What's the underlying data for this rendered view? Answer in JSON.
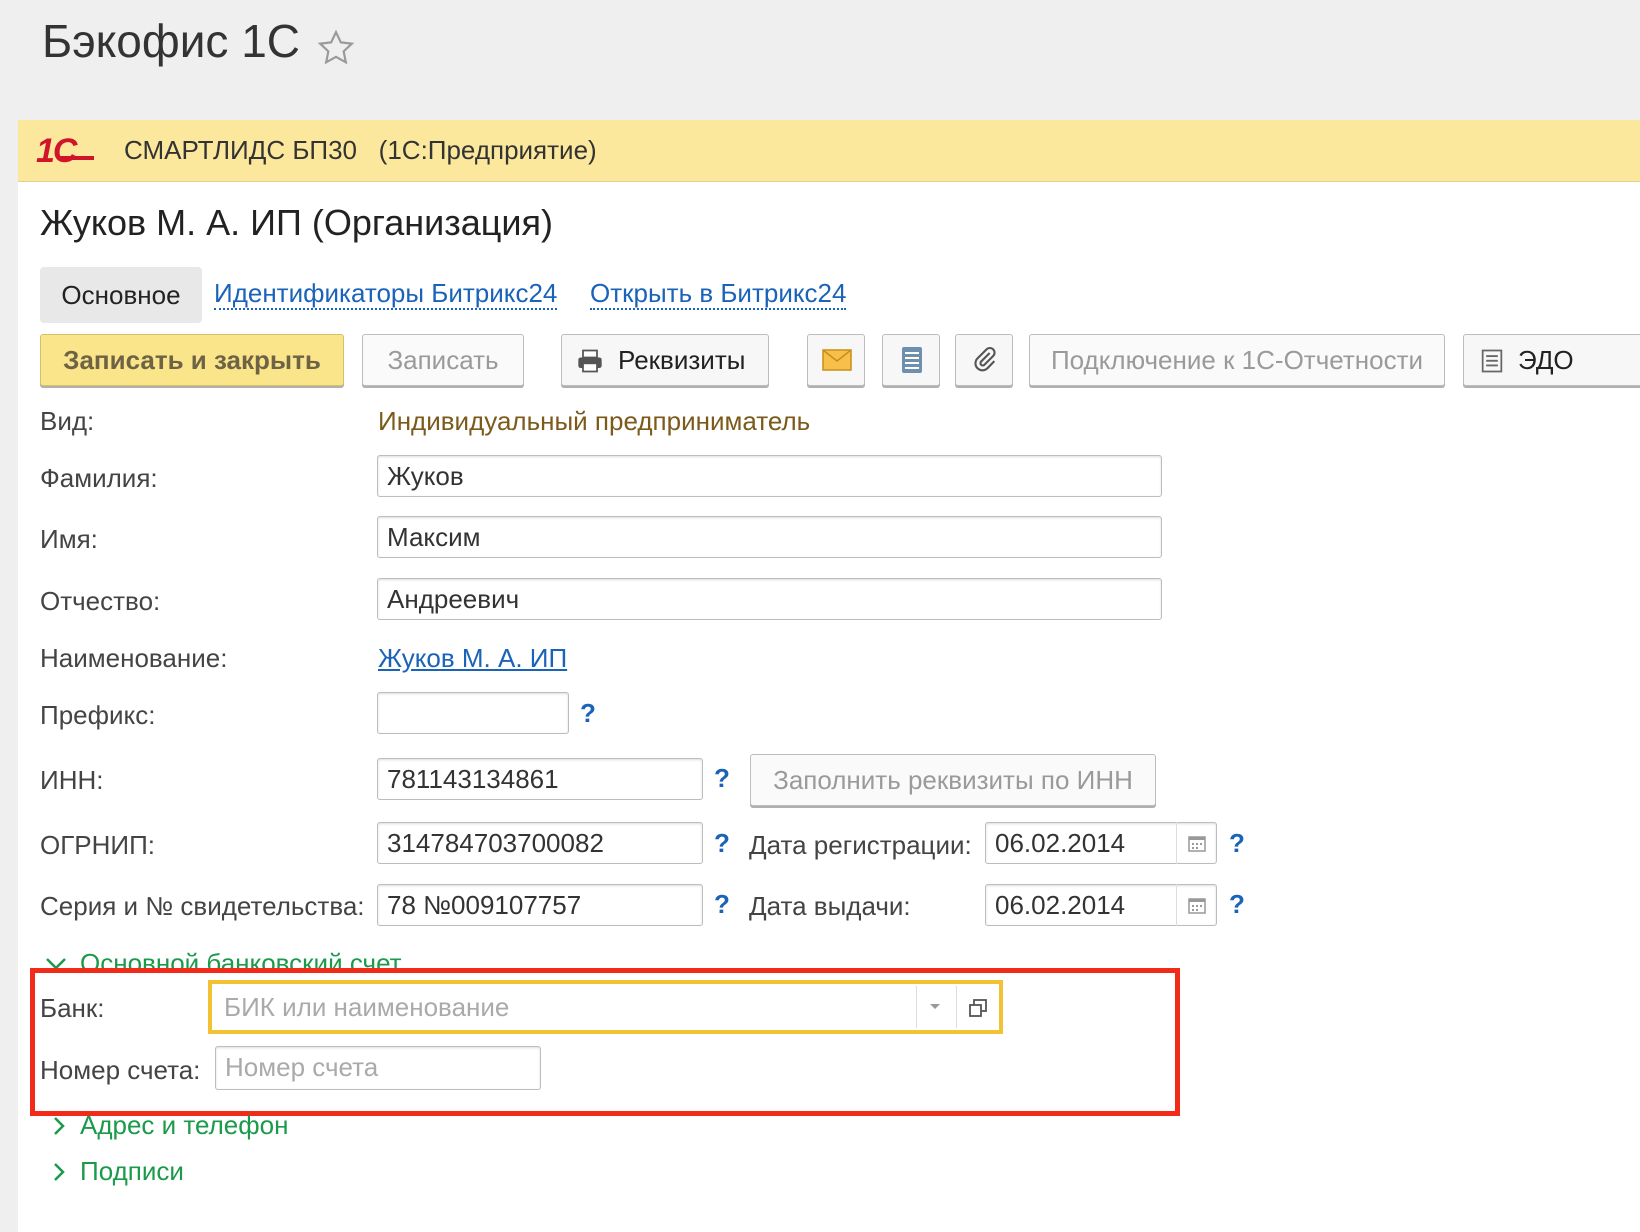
{
  "header": {
    "title": "Бэкофис 1С",
    "star_icon": "star-outline-icon"
  },
  "appbar": {
    "logo": "1С",
    "title": "СМАРТЛИДС БП30   (1С:Предприятие)"
  },
  "form": {
    "title": "Жуков М. А. ИП (Организация)",
    "tabs": [
      {
        "label": "Основное",
        "active": true
      },
      {
        "label": "Идентификаторы Битрикс24",
        "active": false
      },
      {
        "label": "Открыть в Битрикс24",
        "active": false
      }
    ],
    "toolbar": {
      "save_close": "Записать и закрыть",
      "save": "Записать",
      "requisites": "Реквизиты",
      "icons": [
        "envelope-icon",
        "list-icon",
        "paperclip-icon"
      ],
      "reporting": "Подключение к 1С-Отчетности",
      "edo": "ЭДО"
    },
    "fields": {
      "vid": {
        "label": "Вид:",
        "value": "Индивидуальный предприниматель"
      },
      "surname": {
        "label": "Фамилия:",
        "value": "Жуков"
      },
      "name": {
        "label": "Имя:",
        "value": "Максим"
      },
      "patronymic": {
        "label": "Отчество:",
        "value": "Андреевич"
      },
      "naming": {
        "label": "Наименование:",
        "value": "Жуков М. А. ИП"
      },
      "prefix": {
        "label": "Префикс:",
        "value": ""
      },
      "inn": {
        "label": "ИНН:",
        "value": "781143134861",
        "fill_button": "Заполнить реквизиты по ИНН"
      },
      "ogrnip": {
        "label": "ОГРНИП:",
        "value": "314784703700082"
      },
      "reg_date": {
        "label": "Дата регистрации:",
        "value": "06.02.2014"
      },
      "cert": {
        "label": "Серия и № свидетельства:",
        "value": "78 №009107757"
      },
      "issue_date": {
        "label": "Дата выдачи:",
        "value": "06.02.2014"
      },
      "help": "?"
    },
    "bank_group": {
      "title": "Основной банковский счет",
      "bank_label": "Банк:",
      "bank_placeholder": "БИК или наименование",
      "account_label": "Номер счета:",
      "account_placeholder": "Номер счета"
    },
    "groups": [
      "Адрес и телефон",
      "Подписи"
    ]
  }
}
